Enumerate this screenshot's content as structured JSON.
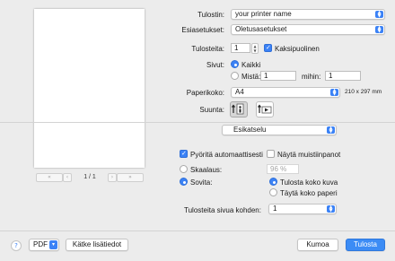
{
  "preview": {
    "prev_first": "«",
    "prev": "‹",
    "page_indicator": "1 / 1",
    "next": "›",
    "next_last": "»"
  },
  "printer": {
    "label": "Tulostin:",
    "value": "your printer name"
  },
  "presets": {
    "label": "Esiasetukset:",
    "value": "Oletusasetukset"
  },
  "copies": {
    "label": "Tulosteita:",
    "value": "1",
    "two_sided_label": "Kaksipuolinen",
    "two_sided_checked": true
  },
  "pages": {
    "label": "Sivut:",
    "all_label": "Kaikki",
    "all_selected": true,
    "from_label": "Mistä:",
    "from_value": "1",
    "to_label": "mihin:",
    "to_value": "1"
  },
  "paper_size": {
    "label": "Paperikoko:",
    "value": "A4",
    "dimensions": "210 x 297 mm"
  },
  "orientation": {
    "label": "Suunta:",
    "selected": "portrait"
  },
  "section": {
    "value": "Esikatselu"
  },
  "options": {
    "auto_rotate_label": "Pyöritä automaattisesti",
    "auto_rotate_checked": true,
    "show_notes_label": "Näytä muistiinpanot",
    "show_notes_checked": false,
    "scale_label": "Skaalaus:",
    "scale_value": "96 %",
    "fit_label": "Sovita:",
    "fit_selected": true,
    "print_entire_label": "Tulosta koko kuva",
    "print_entire_selected": true,
    "fill_paper_label": "Täytä koko paperi",
    "fill_paper_selected": false
  },
  "copies_per_page": {
    "label": "Tulosteita sivua kohden:",
    "value": "1"
  },
  "footer": {
    "help": "?",
    "pdf_label": "PDF",
    "hide_details_label": "Kätke lisätiedot",
    "cancel_label": "Kumoa",
    "print_label": "Tulosta"
  },
  "icons": {
    "popup_arrow": "chevron-updown-icon",
    "portrait": "portrait-orientation-icon",
    "landscape": "landscape-orientation-icon"
  },
  "colors": {
    "accent": "#3b82f6",
    "background": "#ececec"
  }
}
